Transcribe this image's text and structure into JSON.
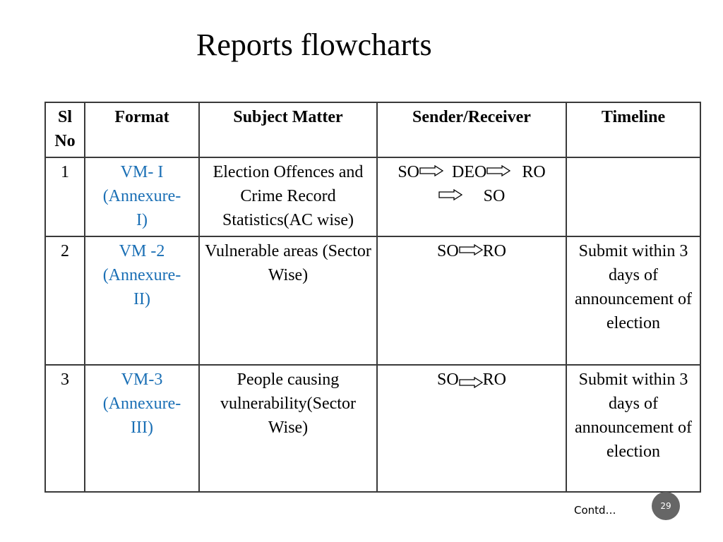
{
  "slide": {
    "title": "Reports flowcharts",
    "footer_note": "Contd…",
    "page_number": "29",
    "link_color": "#1a6fb5"
  },
  "table": {
    "headers": [
      "Sl No",
      "Format",
      "Subject Matter",
      "Sender/Receiver",
      "Timeline"
    ],
    "rows": [
      {
        "sl": "1",
        "format_line1": "VM- I",
        "format_line2": "(Annexure-",
        "format_line3": "I)",
        "subject": "Election Offences and Crime Record Statistics(AC wise)",
        "flow": [
          "SO",
          "DEO",
          "RO",
          "SO"
        ],
        "timeline": ""
      },
      {
        "sl": "2",
        "format_line1": "VM -2",
        "format_line2": "(Annexure-",
        "format_line3": "II)",
        "subject": "Vulnerable areas (Sector Wise)",
        "flow": [
          "SO",
          "RO"
        ],
        "timeline": "Submit within 3 days of announcement of election"
      },
      {
        "sl": "3",
        "format_line1": "VM-3",
        "format_line2": "(Annexure-",
        "format_line3": "III)",
        "subject": "People causing vulnerability(Sector Wise)",
        "flow": [
          "SO",
          "RO"
        ],
        "timeline": "Submit within 3 days of announcement of election"
      }
    ]
  },
  "icons": {
    "flow_arrow": "right-double-arrow-icon"
  }
}
